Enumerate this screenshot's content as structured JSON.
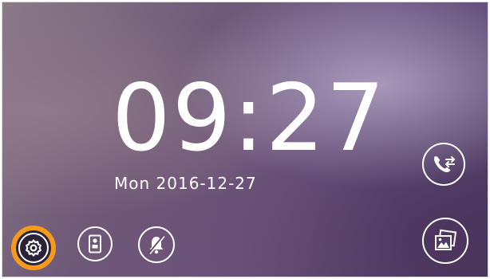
{
  "clock": {
    "time": "09:27",
    "date": "Mon 2016-12-27"
  },
  "buttons": {
    "settings": {
      "icon": "gear-icon",
      "highlight_color": "#f59a1c"
    },
    "monitor": {
      "icon": "door-station-icon"
    },
    "mute": {
      "icon": "bell-muted-icon"
    },
    "calls": {
      "icon": "phone-transfer-icon"
    },
    "gallery": {
      "icon": "photo-gallery-icon"
    }
  }
}
